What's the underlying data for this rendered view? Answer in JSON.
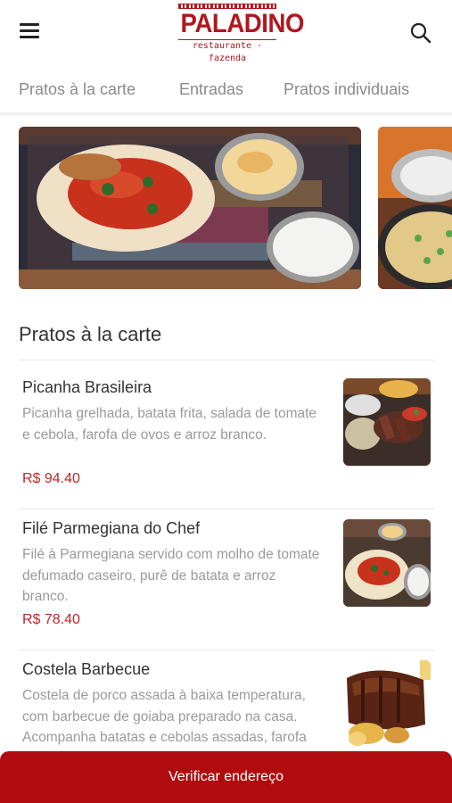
{
  "header": {
    "logo_name": "PALADINO",
    "logo_subtitle": "restaurante · fazenda",
    "menu_icon": "hamburger-menu-icon",
    "search_icon": "search-icon"
  },
  "tabs": [
    {
      "label": "Pratos à la carte"
    },
    {
      "label": "Entradas"
    },
    {
      "label": "Pratos individuais"
    }
  ],
  "banner": {
    "images": [
      "parmegiana-platter-photo",
      "rice-pan-photo"
    ]
  },
  "section": {
    "title": "Pratos à la carte"
  },
  "items": [
    {
      "name": "Picanha Brasileira",
      "description": "Picanha grelhada, batata frita, salada de tomate e cebola, farofa de ovos e arroz branco.",
      "price": "R$ 94.40"
    },
    {
      "name": "Filé Parmegiana do Chef",
      "description": "Filé à Parmegiana servido com molho de tomate defumado caseiro, purê de batata e arroz branco.",
      "price": "R$ 78.40"
    },
    {
      "name": "Costela Barbecue",
      "description": "Costela de porco assada à baixa temperatura, com barbecue de goiaba preparado na casa. Acompanha batatas e cebolas assadas, farofa",
      "price": ""
    }
  ],
  "cta": {
    "label": "Verificar endereço"
  },
  "colors": {
    "brand_red": "#b2161d",
    "price_red": "#c0262b",
    "cta_red": "#b00c10"
  }
}
